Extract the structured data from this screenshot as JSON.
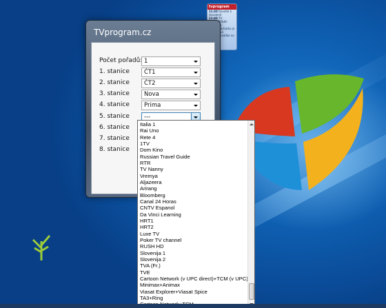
{
  "window": {
    "title": "TVprogram.cz",
    "count_label": "Počet pořadů:",
    "count_value": "1",
    "stations": [
      {
        "label": "1. stanice",
        "value": "ČT1"
      },
      {
        "label": "2. stanice",
        "value": "ČT2"
      },
      {
        "label": "3. stanice",
        "value": "Nova"
      },
      {
        "label": "4. stanice",
        "value": "Prima"
      },
      {
        "label": "5. stanice",
        "value": "---"
      },
      {
        "label": "6. stanice",
        "value": ""
      },
      {
        "label": "7. stanice",
        "value": ""
      },
      {
        "label": "8. stanice",
        "value": ""
      }
    ]
  },
  "dropdown": {
    "items": [
      "Italia 1",
      "Rai Uno",
      "Rete 4",
      "1TV",
      "Dom Kino",
      "Russian Travel Guide",
      "RTR",
      "TV Nanny",
      "Vremya",
      "Aljazeera",
      "Arirang",
      "Bloomberg",
      "Canal 24 Horas",
      "CNTV Espanol",
      "Da Vinci Learning",
      "HRT1",
      "HRT2",
      "Luxe TV",
      "Poker TV channel",
      "RUSH HD",
      "Slovenija 1",
      "Slovenija 2",
      "TVA (Fr.)",
      "TVE",
      "Cartoon Network (v UPC direct)+TCM (v UPC)",
      "Minimax+Animax",
      "Viasat Explorer+Viasat Spice",
      "TA3+Ring",
      "Cartoon Network+TCM",
      ""
    ],
    "selected_index": 29
  },
  "gadget": {
    "header": "tvprogram",
    "rows": [
      {
        "time": "11:30",
        "text": "Dovolte k dovolené"
      },
      {
        "time": "11:40",
        "text": "TV"
      },
      {
        "time": "11:30",
        "text": "Příběh rozhodne"
      },
      {
        "time": "11:45",
        "text": "Záchytka je zkoušková"
      },
      {
        "time": "11:40",
        "text": "Posádka na nohou"
      }
    ]
  },
  "colors": {
    "selection": "#3399ff",
    "accent": "#3c7fb1"
  }
}
